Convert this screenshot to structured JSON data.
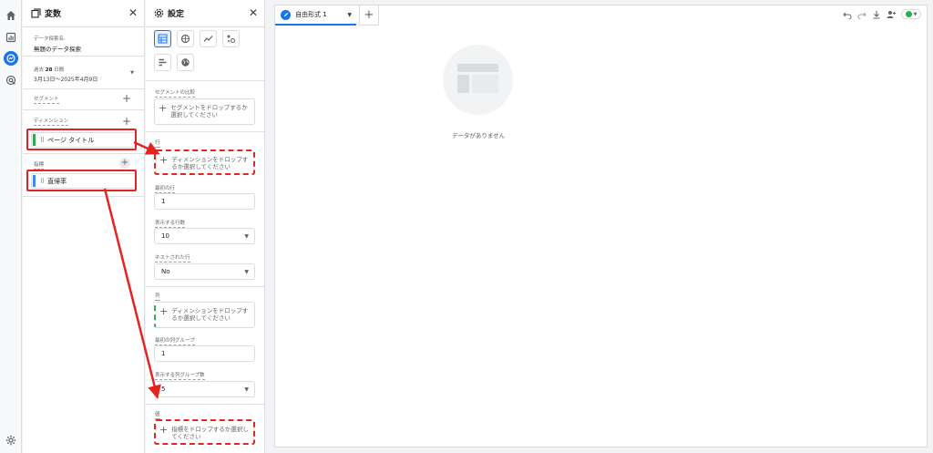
{
  "rail": {
    "items": [
      "home-icon",
      "reports-icon",
      "explore-icon",
      "advertising-icon"
    ],
    "bottom": "settings-icon"
  },
  "variables_panel": {
    "title": "変数",
    "exploration_name_label": "データ探索名:",
    "exploration_name": "無題のデータ探索",
    "date_range_prefix": "過去",
    "date_range_days": "28",
    "date_range_unit": "日間",
    "date_range": "3月13日～2025年4月9日",
    "segments_label": "セグメント",
    "dimensions_label": "ディメンション",
    "dimension_chip": "ページ タイトル",
    "metrics_label": "指標",
    "metric_chip": "直帰率"
  },
  "settings_panel": {
    "title": "設定",
    "segment_compare_label": "セグメントの比較",
    "segment_drop_text": "セグメントをドロップするか選択してください",
    "rows_label": "行",
    "rows_drop_text": "ディメンションをドロップするか選択してください",
    "first_row_label": "最初の行",
    "first_row_value": "1",
    "rows_shown_label": "表示する行数",
    "rows_shown_value": "10",
    "nested_rows_label": "ネストされた行",
    "nested_rows_value": "No",
    "columns_label": "列",
    "columns_drop_text": "ディメンションをドロップするか選択してください",
    "first_col_group_label": "最初の列グループ",
    "first_col_group_value": "1",
    "col_groups_shown_label": "表示する列グループ数",
    "col_groups_shown_value": "5",
    "values_label": "値",
    "values_drop_text": "指標をドロップするか選択してください"
  },
  "canvas": {
    "tab_label": "自由形式 1",
    "empty_message": "データがありません"
  },
  "colors": {
    "accent": "#1a73e8",
    "annotation_red": "#e52421",
    "dimension_green": "#34a853",
    "metric_blue": "#4285f4"
  }
}
